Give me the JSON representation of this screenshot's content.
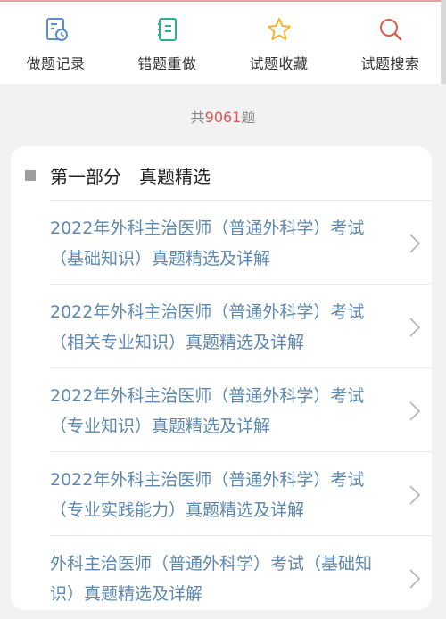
{
  "toolbar": {
    "items": [
      {
        "label": "做题记录",
        "icon": "history-clock-icon"
      },
      {
        "label": "错题重做",
        "icon": "notebook-redo-icon"
      },
      {
        "label": "试题收藏",
        "icon": "star-icon"
      },
      {
        "label": "试题搜索",
        "icon": "search-icon"
      }
    ]
  },
  "summary": {
    "prefix": "共",
    "count": "9061",
    "suffix": "题"
  },
  "section": {
    "title": "第一部分　真题精选"
  },
  "list": [
    {
      "text": "2022年外科主治医师（普通外科学）考试（基础知识）真题精选及详解"
    },
    {
      "text": "2022年外科主治医师（普通外科学）考试（相关专业知识）真题精选及详解"
    },
    {
      "text": "2022年外科主治医师（普通外科学）考试（专业知识）真题精选及详解"
    },
    {
      "text": "2022年外科主治医师（普通外科学）考试（专业实践能力）真题精选及详解"
    },
    {
      "text": "外科主治医师（普通外科学）考试（基础知识）真题精选及详解"
    }
  ],
  "colors": {
    "accent_blue": "#5d88b0",
    "toolbar_icon_blue": "#5b8fc9",
    "toolbar_icon_green": "#2fae8a",
    "star_yellow": "#f2b531",
    "search_red": "#e05a4a",
    "count_red": "#e05656"
  }
}
